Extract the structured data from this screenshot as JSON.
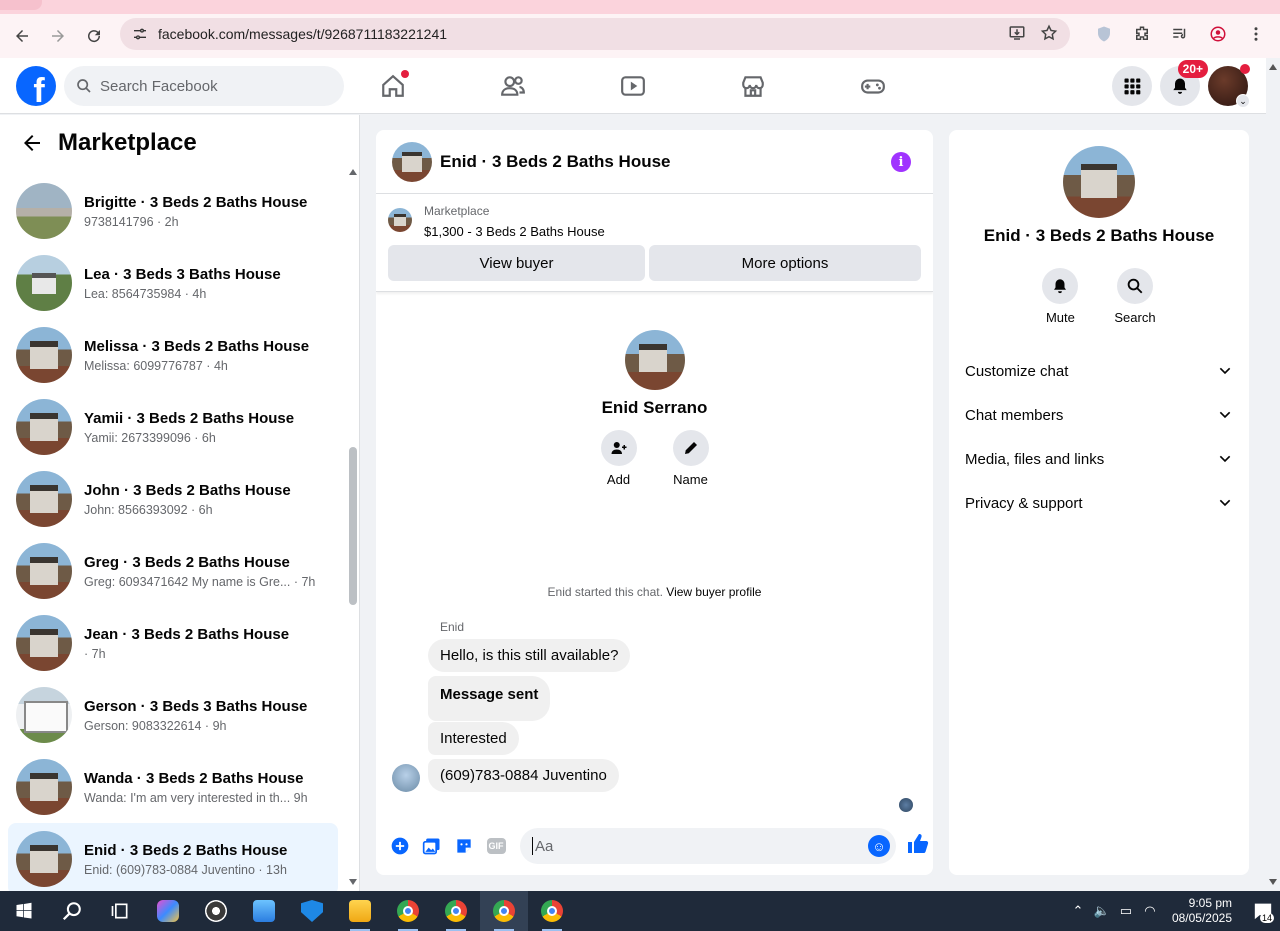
{
  "browser": {
    "url": "facebook.com/messages/t/9268711183221241"
  },
  "fbnav": {
    "search_placeholder": "Search Facebook",
    "notifications_badge": "20+",
    "logo_letter": "f"
  },
  "sidebar": {
    "title": "Marketplace",
    "conversations": [
      {
        "title": "Brigitte · 3 Beds 2 Baths House",
        "subtitle": "9738141796 · 2h",
        "thumb": "lawn"
      },
      {
        "title": "Lea · 3 Beds 3 Baths House",
        "subtitle": "Lea: 8564735984 · 4h",
        "thumb": "green"
      },
      {
        "title": "Melissa · 3 Beds 2 Baths House",
        "subtitle": "Melissa: 6099776787 · 4h",
        "thumb": "house"
      },
      {
        "title": "Yamii · 3 Beds 2 Baths House",
        "subtitle": "Yamii: 2673399096 · 6h",
        "thumb": "house"
      },
      {
        "title": "John · 3 Beds 2 Baths House",
        "subtitle": "John: 8566393092 · 6h",
        "thumb": "house"
      },
      {
        "title": "Greg · 3 Beds 2 Baths House",
        "subtitle": "Greg: 6093471642 My name is Gre... · 7h",
        "thumb": "house"
      },
      {
        "title": "Jean · 3 Beds 2 Baths House",
        "subtitle": " · 7h",
        "thumb": "house"
      },
      {
        "title": "Gerson · 3 Beds 3 Baths House",
        "subtitle": "Gerson: 9083322614 · 9h",
        "thumb": "white"
      },
      {
        "title": "Wanda · 3 Beds 2 Baths House",
        "subtitle": "Wanda: I'm am very interested in th... 9h",
        "thumb": "house"
      },
      {
        "title": "Enid · 3 Beds 2 Baths House",
        "subtitle": "Enid: (609)783-0884 Juventino · 13h",
        "thumb": "house",
        "active": true
      }
    ]
  },
  "chat": {
    "title": "Enid · 3 Beds 2 Baths House",
    "info_icon": "i",
    "marketplace_label": "Marketplace",
    "listing": "$1,300 - 3 Beds 2 Baths House",
    "view_buyer": "View buyer",
    "more_options": "More options",
    "profile_name": "Enid Serrano",
    "add_label": "Add",
    "name_label": "Name",
    "started_text": "Enid started this chat.",
    "view_buyer_profile": "View buyer profile",
    "sender": "Enid",
    "messages": [
      "Hello, is this still available?",
      "Message sent",
      "Interested",
      "(609)783-0884 Juventino"
    ],
    "composer_placeholder": "Aa",
    "gif_label": "GIF",
    "emoji_icon": "☺"
  },
  "details": {
    "title": "Enid · 3 Beds 2 Baths House",
    "mute_label": "Mute",
    "search_label": "Search",
    "items": [
      "Customize chat",
      "Chat members",
      "Media, files and links",
      "Privacy & support"
    ]
  },
  "taskbar": {
    "time": "9:05 pm",
    "date": "08/05/2025",
    "notification_count": "14"
  },
  "colors": {
    "fb_blue": "#0866ff",
    "active_row": "#ebf5ff",
    "badge_red": "#e41e3f",
    "info_purple": "#a033ff"
  }
}
